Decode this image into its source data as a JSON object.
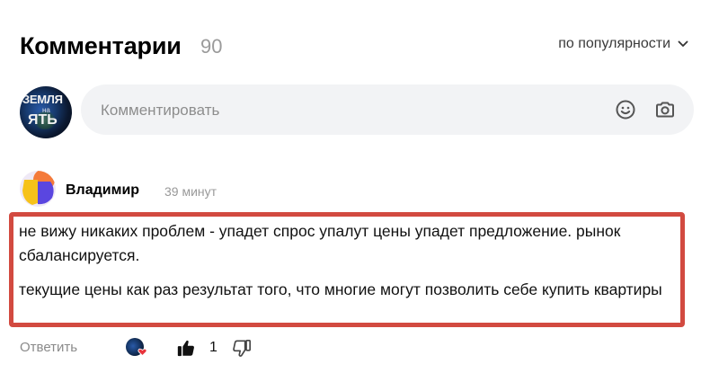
{
  "header": {
    "title": "Комментарии",
    "count": "90",
    "sort_label": "по популярности",
    "sort_icon": "chevron-down-icon"
  },
  "composer": {
    "avatar_text_line1": "ЗЕМЛЯ",
    "avatar_text_line2": "на",
    "avatar_text_line3": "ЯТЬ",
    "placeholder": "Комментировать",
    "emoji_icon": "smiley-icon",
    "camera_icon": "camera-icon"
  },
  "comment": {
    "author": "Владимир",
    "time": "39 минут",
    "paragraphs": [
      "не вижу никаких проблем - упадет спрос упалут цены упадет предложение. рынок сбалансируется.",
      "текущие цены как раз результат того, что многие могут позволить себе купить квартиры"
    ],
    "highlight_color": "#d24a40",
    "actions": {
      "reply_label": "Ответить",
      "likes": "1",
      "like_icon": "thumbs-up-icon",
      "dislike_icon": "thumbs-down-icon",
      "reaction_icon": "heart-icon"
    }
  }
}
